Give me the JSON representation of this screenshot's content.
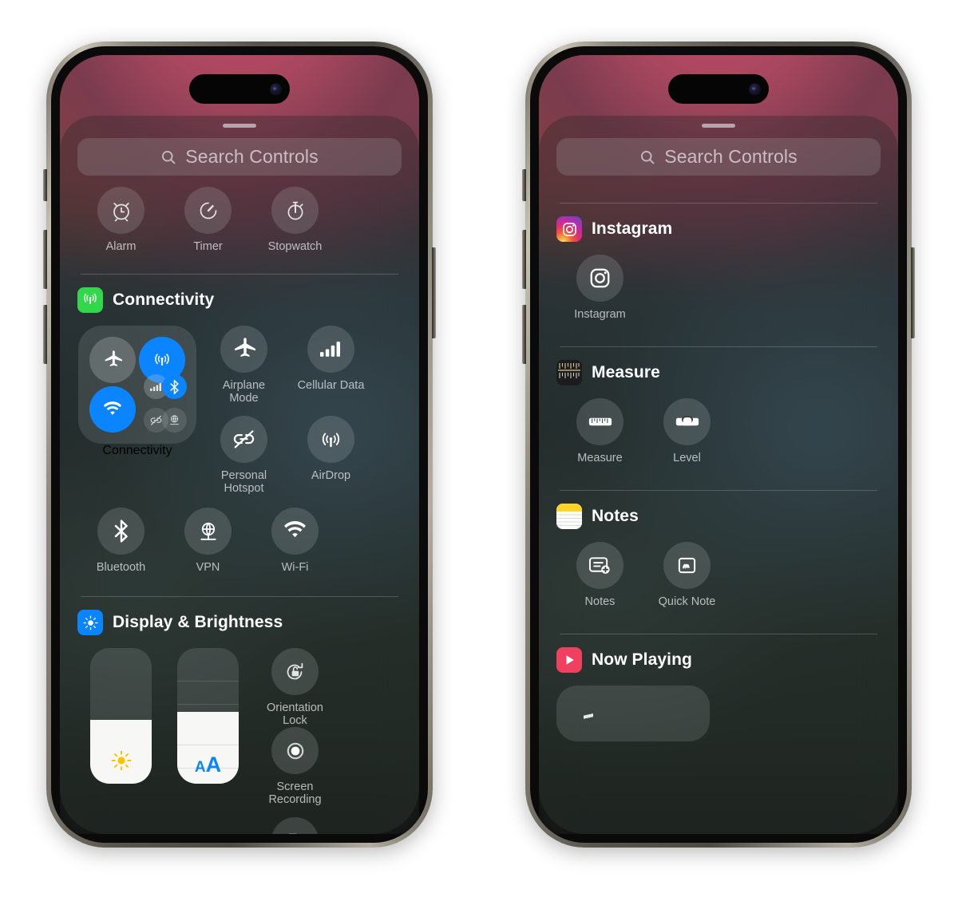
{
  "phones": [
    {
      "id": "phone-1",
      "name": "iphone-left",
      "search": {
        "placeholder": "Search Controls",
        "icon": "search-icon"
      },
      "sections": [
        {
          "name": "clock-controls",
          "header": null,
          "tiles": [
            {
              "label": "Alarm",
              "icon": "alarm-clock-icon"
            },
            {
              "label": "Timer",
              "icon": "timer-icon"
            },
            {
              "label": "Stopwatch",
              "icon": "stopwatch-icon"
            }
          ]
        },
        {
          "name": "connectivity",
          "header": {
            "title": "Connectivity",
            "icon": "connectivity-app-icon",
            "color": "#32d74b"
          },
          "module": {
            "label": "Connectivity",
            "toggles": [
              {
                "name": "airplane-mode",
                "state": "off"
              },
              {
                "name": "cellular-data",
                "state": "on"
              },
              {
                "name": "wifi",
                "state": "on"
              },
              {
                "name": "signal",
                "state": "off"
              },
              {
                "name": "bluetooth",
                "state": "on"
              },
              {
                "name": "personal-hotspot",
                "state": "off"
              },
              {
                "name": "vpn",
                "state": "off"
              }
            ]
          },
          "tiles": [
            {
              "label": "Airplane\nMode",
              "icon": "airplane-icon"
            },
            {
              "label": "Cellular Data",
              "icon": "cellular-bars-icon"
            },
            {
              "label": "Personal\nHotspot",
              "icon": "hotspot-off-icon"
            },
            {
              "label": "AirDrop",
              "icon": "airdrop-icon"
            },
            {
              "label": "Bluetooth",
              "icon": "bluetooth-icon"
            },
            {
              "label": "VPN",
              "icon": "vpn-globe-icon"
            },
            {
              "label": "Wi-Fi",
              "icon": "wifi-icon"
            }
          ]
        },
        {
          "name": "display-brightness",
          "header": {
            "title": "Display & Brightness",
            "icon": "brightness-app-icon",
            "color": "#0a84ff"
          },
          "sliders": [
            {
              "name": "brightness-slider",
              "icon": "sun-icon",
              "value": 47
            },
            {
              "name": "text-size-slider",
              "icon": "text-size-icon",
              "value": 47,
              "label": "AA"
            }
          ],
          "tiles": [
            {
              "label": "Orientation\nLock",
              "icon": "rotation-lock-icon"
            },
            {
              "label": "Screen\nRecording",
              "icon": "screen-record-icon"
            },
            {
              "label": "",
              "icon": "stage-manager-icon"
            },
            {
              "label": "",
              "icon": "dark-mode-icon"
            }
          ]
        }
      ]
    },
    {
      "id": "phone-2",
      "name": "iphone-right",
      "search": {
        "placeholder": "Search Controls",
        "icon": "search-icon"
      },
      "sections": [
        {
          "name": "instagram",
          "header": {
            "title": "Instagram",
            "icon": "instagram-app-icon"
          },
          "tiles": [
            {
              "label": "Instagram",
              "icon": "instagram-icon"
            }
          ]
        },
        {
          "name": "measure",
          "header": {
            "title": "Measure",
            "icon": "measure-app-icon"
          },
          "tiles": [
            {
              "label": "Measure",
              "icon": "ruler-icon"
            },
            {
              "label": "Level",
              "icon": "level-icon"
            }
          ]
        },
        {
          "name": "notes",
          "header": {
            "title": "Notes",
            "icon": "notes-app-icon"
          },
          "tiles": [
            {
              "label": "Notes",
              "icon": "new-note-icon"
            },
            {
              "label": "Quick Note",
              "icon": "quick-note-icon"
            }
          ]
        },
        {
          "name": "now-playing",
          "header": {
            "title": "Now Playing",
            "icon": "now-playing-app-icon",
            "color": "#f0405f"
          },
          "tiles": []
        }
      ]
    }
  ],
  "colors": {
    "accent_blue": "#0a84ff",
    "green": "#32d74b",
    "pink": "#f0405f",
    "yellow": "#ffc400",
    "panel": "rgba(36,40,40,0.33)"
  }
}
